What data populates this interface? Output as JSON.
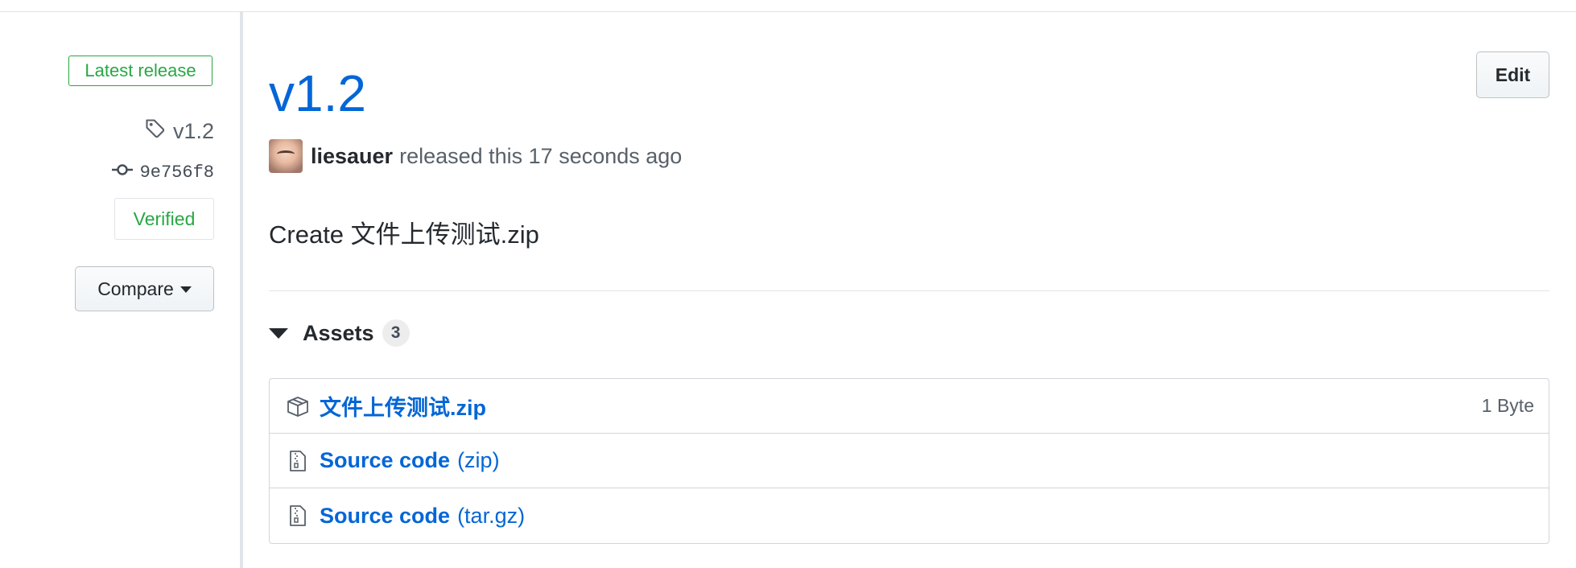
{
  "sidebar": {
    "latest_badge": "Latest release",
    "tag": "v1.2",
    "commit": "9e756f8",
    "verified": "Verified",
    "compare_label": "Compare"
  },
  "release": {
    "title": "v1.2",
    "edit_label": "Edit",
    "author": "liesauer",
    "released_text": "released this 17 seconds ago",
    "body": "Create 文件上传测试.zip"
  },
  "assets": {
    "label": "Assets",
    "count": "3",
    "items": [
      {
        "name": "文件上传测试.zip",
        "suffix": "",
        "size": "1 Byte",
        "icon": "package-icon"
      },
      {
        "name": "Source code",
        "suffix": "(zip)",
        "size": "",
        "icon": "file-zip-icon"
      },
      {
        "name": "Source code",
        "suffix": "(tar.gz)",
        "size": "",
        "icon": "file-zip-icon"
      }
    ]
  },
  "colors": {
    "link": "#0366d6",
    "success": "#28a745",
    "border": "#d1d5da",
    "muted": "#586069"
  }
}
